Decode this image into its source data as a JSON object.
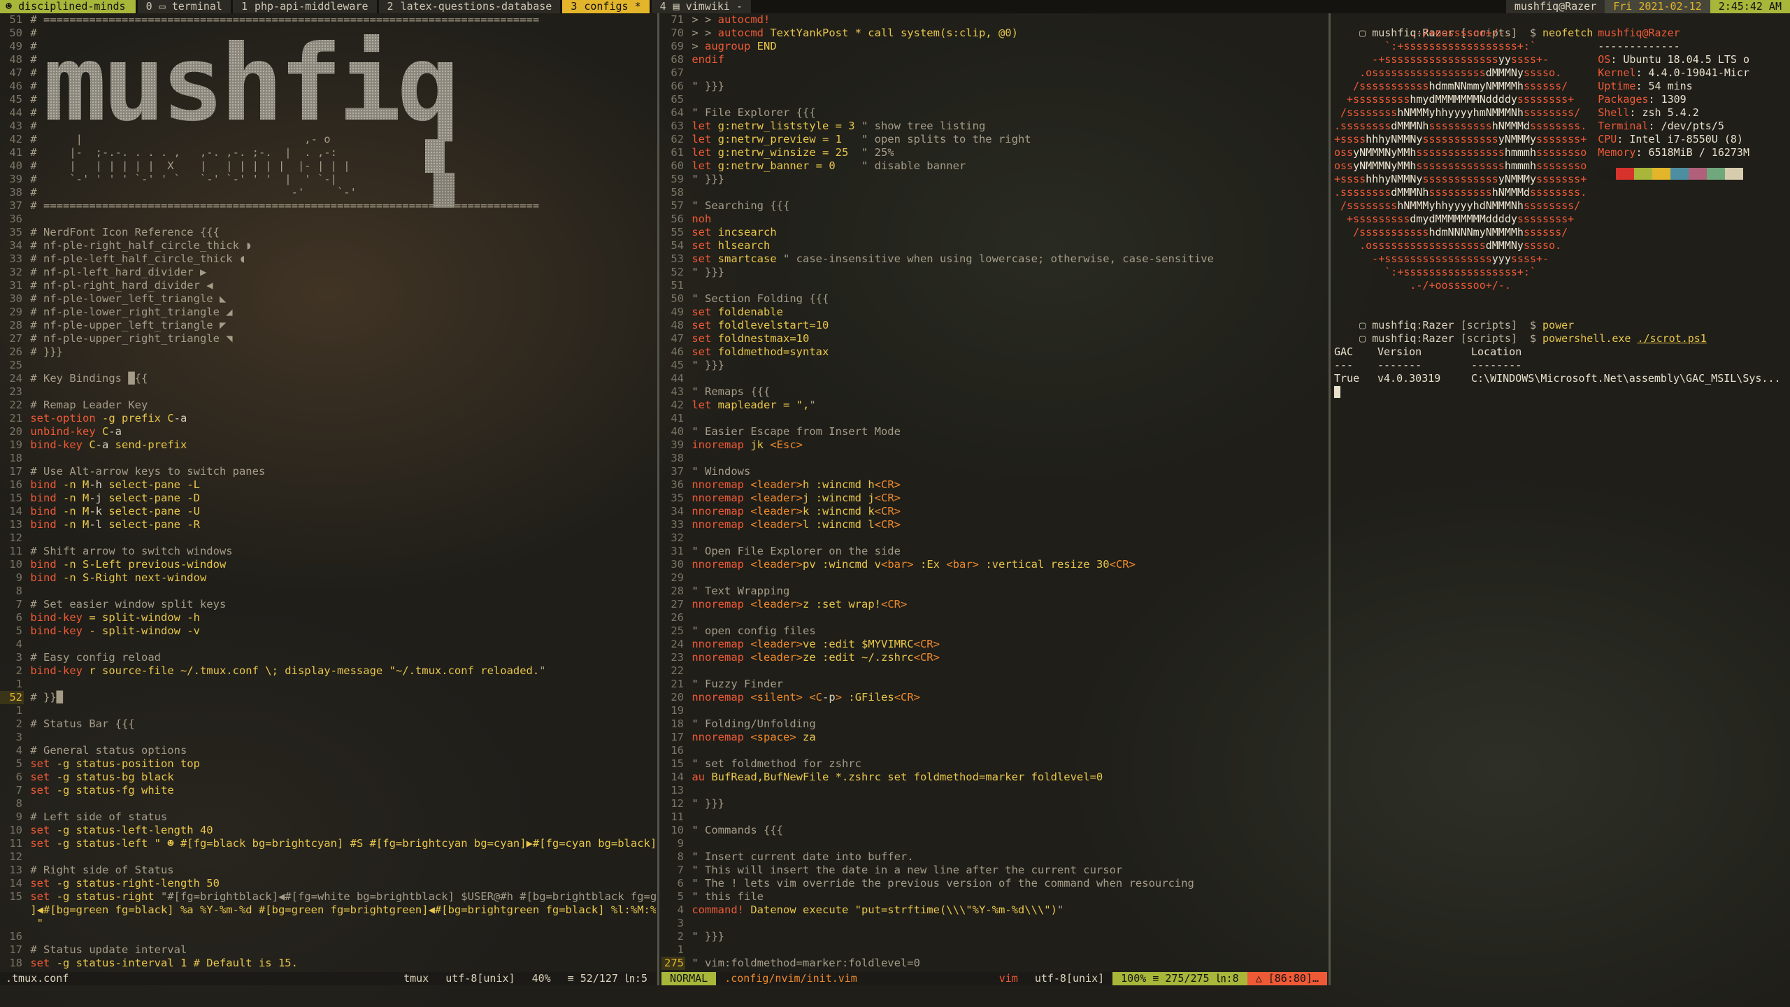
{
  "tmux": {
    "session": "disciplined-minds",
    "windows": [
      {
        "index": "0",
        "name": "terminal",
        "icon": "terminal-icon"
      },
      {
        "index": "1",
        "name": "php-api-middleware",
        "icon": ""
      },
      {
        "index": "2",
        "name": "latex-questions-database",
        "icon": ""
      },
      {
        "index": "3",
        "name": "configs *",
        "icon": "",
        "active": true
      },
      {
        "index": "4",
        "name": "vimwiki -",
        "icon": "file-icon"
      }
    ],
    "host": "mushfiq@Razer",
    "date": "Fri 2021-02-12",
    "time": "2:45:42 AM"
  },
  "left": {
    "lines": [
      {
        "n": "51",
        "t": "# ============================================================================",
        "c": "com"
      },
      {
        "n": "50",
        "t": "#",
        "c": "com"
      },
      {
        "n": "49",
        "t": "#",
        "c": "com"
      },
      {
        "n": "48",
        "t": "#",
        "c": "com"
      },
      {
        "n": "47",
        "t": "#",
        "c": "com"
      },
      {
        "n": "46",
        "t": "#",
        "c": "com"
      },
      {
        "n": "45",
        "t": "#",
        "c": "com"
      },
      {
        "n": "44",
        "t": "#",
        "c": "com"
      },
      {
        "n": "43",
        "t": "#",
        "c": "com"
      },
      {
        "n": "42",
        "t": "#      |                                  ,- o",
        "c": "com"
      },
      {
        "n": "41",
        "t": "#     |-  ;-.-. . . . ,   ,-. ,-. ;-.  |  . ,-:",
        "c": "com"
      },
      {
        "n": "40",
        "t": "#     |   | | | | |  X    |   | | | | |  |- | | |",
        "c": "com"
      },
      {
        "n": "39",
        "t": "#     `-' ' ' ' `-' ' `   `-' `-' ' '  |  ' `-|",
        "c": "com"
      },
      {
        "n": "38",
        "t": "#                                       -'     `-'",
        "c": "com"
      },
      {
        "n": "37",
        "t": "# ============================================================================",
        "c": "com"
      },
      {
        "n": "36",
        "t": "",
        "c": "com"
      },
      {
        "n": "35",
        "t": "# NerdFont Icon Reference {{{",
        "c": "com"
      },
      {
        "n": "34",
        "t": "# nf-ple-right_half_circle_thick ◗",
        "c": "com"
      },
      {
        "n": "33",
        "t": "# nf-ple-left_half_circle_thick ◖",
        "c": "com"
      },
      {
        "n": "32",
        "t": "# nf-pl-left_hard_divider ▶",
        "c": "com"
      },
      {
        "n": "31",
        "t": "# nf-pl-right_hard_divider ◀",
        "c": "com"
      },
      {
        "n": "30",
        "t": "# nf-ple-lower_left_triangle ◣",
        "c": "com"
      },
      {
        "n": "29",
        "t": "# nf-ple-lower_right_triangle ◢",
        "c": "com"
      },
      {
        "n": "28",
        "t": "# nf-ple-upper_left_triangle ◤",
        "c": "com"
      },
      {
        "n": "27",
        "t": "# nf-ple-upper_right_triangle ◥",
        "c": "com"
      },
      {
        "n": "26",
        "t": "# }}}",
        "c": "com"
      },
      {
        "n": "25",
        "t": "",
        "c": "com"
      },
      {
        "n": "24",
        "t": "# Key Bindings █{{",
        "c": "com"
      },
      {
        "n": "23",
        "t": "",
        "c": "com"
      },
      {
        "n": "22",
        "t": "# Remap Leader Key",
        "c": "com"
      },
      {
        "n": "21",
        "t": "set-option -g prefix C-a",
        "c": "kw"
      },
      {
        "n": "20",
        "t": "unbind-key C-a",
        "c": "kw"
      },
      {
        "n": "19",
        "t": "bind-key C-a send-prefix",
        "c": "kw"
      },
      {
        "n": "18",
        "t": "",
        "c": "com"
      },
      {
        "n": "17",
        "t": "# Use Alt-arrow keys to switch panes",
        "c": "com"
      },
      {
        "n": "16",
        "t": "bind -n M-h select-pane -L",
        "c": "kw"
      },
      {
        "n": "15",
        "t": "bind -n M-j select-pane -D",
        "c": "kw"
      },
      {
        "n": "14",
        "t": "bind -n M-k select-pane -U",
        "c": "kw"
      },
      {
        "n": "13",
        "t": "bind -n M-l select-pane -R",
        "c": "kw"
      },
      {
        "n": "12",
        "t": "",
        "c": "com"
      },
      {
        "n": "11",
        "t": "# Shift arrow to switch windows",
        "c": "com"
      },
      {
        "n": "10",
        "t": "bind -n S-Left previous-window",
        "c": "kw"
      },
      {
        "n": "9",
        "t": "bind -n S-Right next-window",
        "c": "kw"
      },
      {
        "n": "8",
        "t": "",
        "c": "com"
      },
      {
        "n": "7",
        "t": "# Set easier window split keys",
        "c": "com"
      },
      {
        "n": "6",
        "t": "bind-key = split-window -h",
        "c": "kw"
      },
      {
        "n": "5",
        "t": "bind-key - split-window -v",
        "c": "kw"
      },
      {
        "n": "4",
        "t": "",
        "c": "com"
      },
      {
        "n": "3",
        "t": "# Easy config reload",
        "c": "com"
      },
      {
        "n": "2",
        "t": "bind-key r source-file ~/.tmux.conf \\; display-message \"~/.tmux.conf reloaded.\"",
        "c": "kw"
      },
      {
        "n": "1",
        "t": "",
        "c": "com"
      },
      {
        "n": "52",
        "t": "# }}█",
        "c": "com",
        "cur": true
      },
      {
        "n": "1",
        "t": "",
        "c": "com"
      },
      {
        "n": "2",
        "t": "# Status Bar {{{",
        "c": "com"
      },
      {
        "n": "3",
        "t": "",
        "c": "com"
      },
      {
        "n": "4",
        "t": "# General status options",
        "c": "com"
      },
      {
        "n": "5",
        "t": "set -g status-position top",
        "c": "kw"
      },
      {
        "n": "6",
        "t": "set -g status-bg black",
        "c": "kw"
      },
      {
        "n": "7",
        "t": "set -g status-fg white",
        "c": "kw"
      },
      {
        "n": "8",
        "t": "",
        "c": "com"
      },
      {
        "n": "9",
        "t": "# Left side of status",
        "c": "com"
      },
      {
        "n": "10",
        "t": "set -g status-left-length 40",
        "c": "kw"
      },
      {
        "n": "11",
        "t": "set -g status-left \" ☻ #[fg=black bg=brightcyan] #S #[fg=brightcyan bg=cyan]▶#[fg=cyan bg=black]▶ \"",
        "c": "kw"
      },
      {
        "n": "12",
        "t": "",
        "c": "com"
      },
      {
        "n": "13",
        "t": "# Right side of Status",
        "c": "com"
      },
      {
        "n": "14",
        "t": "set -g status-right-length 50",
        "c": "kw"
      },
      {
        "n": "15",
        "t": "set -g status-right \"#[fg=brightblack]◀#[fg=white bg=brightblack] $USER@#h #[bg=brightblack fg=green",
        "c": "kw"
      },
      {
        "n": "",
        "t": "]◀#[bg=green fg=black] %a %Y-%m-%d #[bg=green fg=brightgreen]◀#[bg=brightgreen fg=black] %l:%M:%S %p",
        "c": "str"
      },
      {
        "n": "",
        "t": " \"",
        "c": "str"
      },
      {
        "n": "16",
        "t": "",
        "c": "com"
      },
      {
        "n": "17",
        "t": "# Status update interval",
        "c": "com"
      },
      {
        "n": "18",
        "t": "set -g status-interval 1 # Default is 15.",
        "c": "kw"
      }
    ],
    "banner_text": "mushfiq",
    "status": {
      "file": ".tmux.conf",
      "filetype": "tmux",
      "encoding": "utf-8[unix]",
      "percent": "40%",
      "position": "≡ 52/127 ㏑:5"
    }
  },
  "middle": {
    "lines": [
      {
        "n": "71",
        "t": "> > autocmd!",
        "c": "kw"
      },
      {
        "n": "70",
        "t": "> > autocmd TextYankPost * call system(s:clip, @0)",
        "c": "kw"
      },
      {
        "n": "69",
        "t": "> augroup END",
        "c": "kw"
      },
      {
        "n": "68",
        "t": "endif",
        "c": "kw"
      },
      {
        "n": "67",
        "t": "",
        "c": "com"
      },
      {
        "n": "66",
        "t": "\" }}}",
        "c": "com"
      },
      {
        "n": "65",
        "t": "",
        "c": "com"
      },
      {
        "n": "64",
        "t": "\" File Explorer {{{",
        "c": "com"
      },
      {
        "n": "63",
        "t": "let g:netrw_liststyle = 3 \" show tree listing",
        "c": "kw"
      },
      {
        "n": "62",
        "t": "let g:netrw_preview = 1   \" open splits to the right",
        "c": "kw"
      },
      {
        "n": "61",
        "t": "let g:netrw_winsize = 25  \" 25%",
        "c": "kw"
      },
      {
        "n": "60",
        "t": "let g:netrw_banner = 0    \" disable banner",
        "c": "kw"
      },
      {
        "n": "59",
        "t": "\" }}}",
        "c": "com"
      },
      {
        "n": "58",
        "t": "",
        "c": "com"
      },
      {
        "n": "57",
        "t": "\" Searching {{{",
        "c": "com"
      },
      {
        "n": "56",
        "t": "noh",
        "c": "kw"
      },
      {
        "n": "55",
        "t": "set incsearch",
        "c": "kw"
      },
      {
        "n": "54",
        "t": "set hlsearch",
        "c": "kw"
      },
      {
        "n": "53",
        "t": "set smartcase \" case-insensitive when using lowercase; otherwise, case-sensitive",
        "c": "kw"
      },
      {
        "n": "52",
        "t": "\" }}}",
        "c": "com"
      },
      {
        "n": "51",
        "t": "",
        "c": "com"
      },
      {
        "n": "50",
        "t": "\" Section Folding {{{",
        "c": "com"
      },
      {
        "n": "49",
        "t": "set foldenable",
        "c": "kw"
      },
      {
        "n": "48",
        "t": "set foldlevelstart=10",
        "c": "kw"
      },
      {
        "n": "47",
        "t": "set foldnestmax=10",
        "c": "kw"
      },
      {
        "n": "46",
        "t": "set foldmethod=syntax",
        "c": "kw"
      },
      {
        "n": "45",
        "t": "\" }}}",
        "c": "com"
      },
      {
        "n": "44",
        "t": "",
        "c": "com"
      },
      {
        "n": "43",
        "t": "\" Remaps {{{",
        "c": "com"
      },
      {
        "n": "42",
        "t": "let mapleader = \",\"",
        "c": "kw"
      },
      {
        "n": "41",
        "t": "",
        "c": "com"
      },
      {
        "n": "40",
        "t": "\" Easier Escape from Insert Mode",
        "c": "com"
      },
      {
        "n": "39",
        "t": "inoremap jk <Esc>",
        "c": "kw"
      },
      {
        "n": "38",
        "t": "",
        "c": "com"
      },
      {
        "n": "37",
        "t": "\" Windows",
        "c": "com"
      },
      {
        "n": "36",
        "t": "nnoremap <leader>h :wincmd h<CR>",
        "c": "kw"
      },
      {
        "n": "35",
        "t": "nnoremap <leader>j :wincmd j<CR>",
        "c": "kw"
      },
      {
        "n": "34",
        "t": "nnoremap <leader>k :wincmd k<CR>",
        "c": "kw"
      },
      {
        "n": "33",
        "t": "nnoremap <leader>l :wincmd l<CR>",
        "c": "kw"
      },
      {
        "n": "32",
        "t": "",
        "c": "com"
      },
      {
        "n": "31",
        "t": "\" Open File Explorer on the side",
        "c": "com"
      },
      {
        "n": "30",
        "t": "nnoremap <leader>pv :wincmd v<bar> :Ex <bar> :vertical resize 30<CR>",
        "c": "kw"
      },
      {
        "n": "29",
        "t": "",
        "c": "com"
      },
      {
        "n": "28",
        "t": "\" Text Wrapping",
        "c": "com"
      },
      {
        "n": "27",
        "t": "nnoremap <leader>z :set wrap!<CR>",
        "c": "kw"
      },
      {
        "n": "26",
        "t": "",
        "c": "com"
      },
      {
        "n": "25",
        "t": "\" open config files",
        "c": "com"
      },
      {
        "n": "24",
        "t": "nnoremap <leader>ve :edit $MYVIMRC<CR>",
        "c": "kw"
      },
      {
        "n": "23",
        "t": "nnoremap <leader>ze :edit ~/.zshrc<CR>",
        "c": "kw"
      },
      {
        "n": "22",
        "t": "",
        "c": "com"
      },
      {
        "n": "21",
        "t": "\" Fuzzy Finder",
        "c": "com"
      },
      {
        "n": "20",
        "t": "nnoremap <silent> <C-p> :GFiles<CR>",
        "c": "kw"
      },
      {
        "n": "19",
        "t": "",
        "c": "com"
      },
      {
        "n": "18",
        "t": "\" Folding/Unfolding",
        "c": "com"
      },
      {
        "n": "17",
        "t": "nnoremap <space> za",
        "c": "kw"
      },
      {
        "n": "16",
        "t": "",
        "c": "com"
      },
      {
        "n": "15",
        "t": "\" set foldmethod for zshrc",
        "c": "com"
      },
      {
        "n": "14",
        "t": "au BufRead,BufNewFile *.zshrc set foldmethod=marker foldlevel=0",
        "c": "kw"
      },
      {
        "n": "13",
        "t": "",
        "c": "com"
      },
      {
        "n": "12",
        "t": "\" }}}",
        "c": "com"
      },
      {
        "n": "11",
        "t": "",
        "c": "com"
      },
      {
        "n": "10",
        "t": "\" Commands {{{",
        "c": "com"
      },
      {
        "n": "9",
        "t": "",
        "c": "com"
      },
      {
        "n": "8",
        "t": "\" Insert current date into buffer.",
        "c": "com"
      },
      {
        "n": "7",
        "t": "\" This will insert the date in a new line after the current cursor",
        "c": "com"
      },
      {
        "n": "6",
        "t": "\" The ! lets vim override the previous version of the command when resourcing",
        "c": "com"
      },
      {
        "n": "5",
        "t": "\" this file",
        "c": "com"
      },
      {
        "n": "4",
        "t": "command! Datenow execute \"put=strftime(\\\\\\\"%Y-%m-%d\\\\\\\")\"",
        "c": "kw"
      },
      {
        "n": "3",
        "t": "",
        "c": "com"
      },
      {
        "n": "2",
        "t": "\" }}}",
        "c": "com"
      },
      {
        "n": "1",
        "t": "",
        "c": "com"
      },
      {
        "n": "275",
        "t": "\" vim:foldmethod=marker:foldlevel=0",
        "c": "com",
        "cur": true
      }
    ],
    "status": {
      "mode": "NORMAL",
      "path": ".config/nvim/init.vim",
      "filetype": "vim",
      "encoding": "utf-8[unix]",
      "position": "100% ≡ 275/275 ㏑:8",
      "warning": "△ [86:80]…"
    }
  },
  "right": {
    "prompt1": {
      "user": "mushfiq",
      "host": "Razer",
      "dir": "scripts",
      "cmd": "neofetch"
    },
    "neofetch": {
      "title": "mushfiq@Razer",
      "separator": "-------------",
      "info": [
        {
          "k": "OS",
          "v": "Ubuntu 18.04.5 LTS o"
        },
        {
          "k": "Kernel",
          "v": "4.4.0-19041-Micr"
        },
        {
          "k": "Uptime",
          "v": "54 mins"
        },
        {
          "k": "Packages",
          "v": "1309"
        },
        {
          "k": "Shell",
          "v": "zsh 5.4.2"
        },
        {
          "k": "Terminal",
          "v": "/dev/pts/5"
        },
        {
          "k": "CPU",
          "v": "Intel i7-8550U (8)"
        },
        {
          "k": "Memory",
          "v": "6518MiB / 16273M"
        }
      ],
      "logo": [
        "            .-/+oossssoo+/-.",
        "        `:+ssssssssssssssssss+:`",
        "      -+ssssssssssssssssssyyssss+-",
        "    .ossssssssssssssssssdMMMNysssso.",
        "   /ssssssssssshdmmNNmmyNMMMMhssssss/",
        "  +ssssssssshmydMMMMMMMNddddyssssssss+",
        " /sssssssshNMMMyhhyyyyhmNMMMNhssssssss/",
        ".ssssssssdMMMNhsssssssssshNMMMdssssssss.",
        "+sssshhhyNMMNyssssssssssssyNMMMysssssss+",
        "ossyNMMMNyMMhsssssssssssssshmmmhssssssso",
        "ossyNMMMNyMMhsssssssssssssshmmmhssssssso",
        "+sssshhhyNMMNyssssssssssssyNMMMysssssss+",
        ".ssssssssdMMMNhsssssssssshNMMMdssssssss.",
        " /sssssssshNMMMyhhyyyyhdNMMMNhssssssss/",
        "  +sssssssssdmydMMMMMMMMddddyssssssss+",
        "   /ssssssssssshdmNNNNmyNMMMMhssssss/",
        "    .ossssssssssssssssssdMMMNysssso.",
        "      -+sssssssssssssssssyyyssss+-",
        "        `:+ssssssssssssssssss+:`",
        "            .-/+oossssoo+/-."
      ],
      "swatches": [
        "#1e1d18",
        "#d8322c",
        "#a8b63a",
        "#e3b52a",
        "#4d8fa0",
        "#b0607a",
        "#6ea87c",
        "#d8ccae"
      ]
    },
    "prompt2": {
      "user": "mushfiq",
      "host": "Razer",
      "dir": "scripts",
      "cmd": "power"
    },
    "prompt3": {
      "user": "mushfiq",
      "host": "Razer",
      "dir": "scripts",
      "cmd": "powershell.exe",
      "arg": "./scrot.ps1"
    },
    "table": {
      "headers": [
        "GAC",
        "Version",
        "Location"
      ],
      "dashes": [
        "---",
        "-------",
        "--------"
      ],
      "row": [
        "True",
        "v4.0.30319",
        "C:\\WINDOWS\\Microsoft.Net\\assembly\\GAC_MSIL\\Sys..."
      ]
    }
  }
}
